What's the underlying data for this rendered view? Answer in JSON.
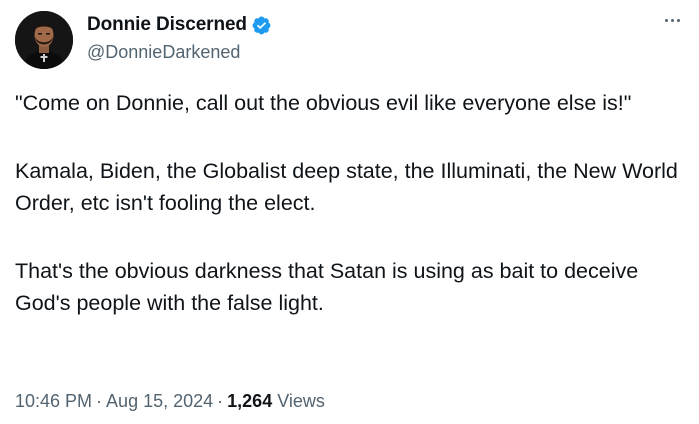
{
  "author": {
    "display_name": "Donnie Discerned",
    "handle": "@DonnieDarkened",
    "verified": true,
    "verified_color": "#1d9bf0"
  },
  "more_icon": "more-horizontal-icon",
  "tweet": {
    "paragraphs": [
      "\"Come on Donnie, call out the obvious evil like everyone else is!\"",
      "Kamala, Biden, the Globalist deep state, the Illuminati, the New World Order, etc isn't fooling the elect.",
      "That's the obvious darkness that Satan is using as bait to deceive God's people with the false light."
    ]
  },
  "meta": {
    "time": "10:46 PM",
    "separator": "·",
    "date": "Aug 15, 2024",
    "views_count": "1,264",
    "views_label": "Views"
  },
  "colors": {
    "primary_text": "#0f1419",
    "secondary_text": "#536471",
    "background": "#ffffff"
  }
}
